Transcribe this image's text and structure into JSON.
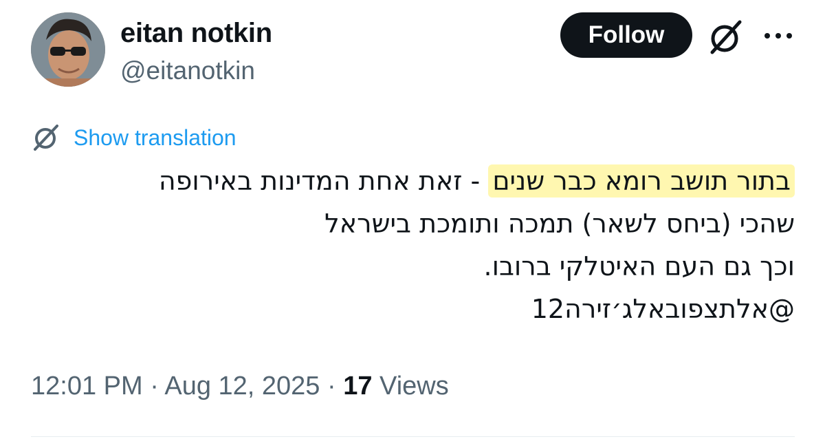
{
  "author": {
    "name": "eitan notkin",
    "handle": "@eitanotkin"
  },
  "actions": {
    "follow_label": "Follow",
    "grok_icon": "grok-icon",
    "more_icon": "more-dots-icon"
  },
  "translation": {
    "icon": "grok-icon",
    "label": "Show translation"
  },
  "tweet": {
    "line1_highlight": "בתור תושב רומא כבר שנים",
    "line1_rest": " - זאת אחת המדינות באירופה",
    "line2": "שהכי (ביחס לשאר) תמכה ותומכת בישראל",
    "line3": "וכך גם העם האיטלקי ברובו.",
    "line4": "@אלתצפובאלג׳זירה12"
  },
  "meta": {
    "time": "12:01 PM",
    "sep1": " · ",
    "date": "Aug 12, 2025",
    "sep2": " · ",
    "views_count": "17",
    "views_label": " Views"
  },
  "colors": {
    "text": "#0f1419",
    "secondary": "#536471",
    "link": "#1d9bf0",
    "highlight": "#fff7b0",
    "button_bg": "#0f1419"
  }
}
